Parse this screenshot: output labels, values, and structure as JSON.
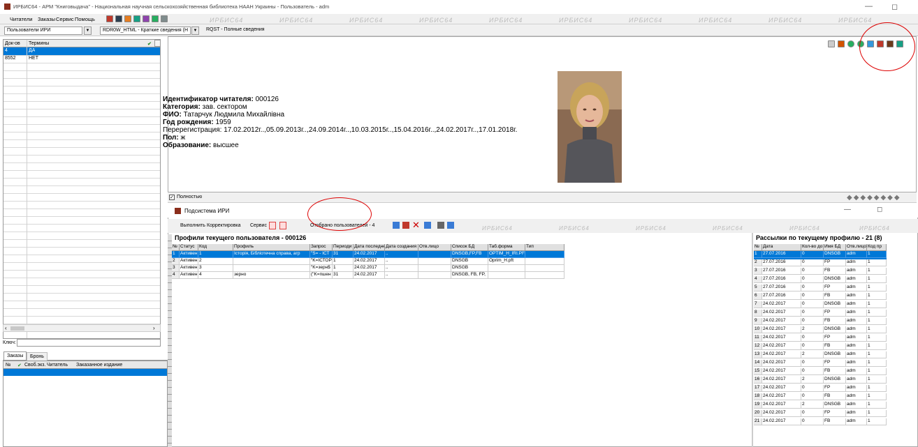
{
  "window": {
    "title": "ИРБИС64 - АРМ \"Книговыдача\" - Национальная научная сельскохозяйственная библиотека НААН Украины - Пользователь - adm",
    "minimize": "—",
    "restore": "◻"
  },
  "menu": [
    "Читатели",
    "Заказы",
    "Сервис",
    "Помощь"
  ],
  "watermark": "ИРБИС64",
  "selectors": {
    "users": "Пользователи ИРИ",
    "format": "RDR0W_HTML - Краткие сведения (Н",
    "query": "RQST - Полные сведения"
  },
  "left_grid": {
    "col1": "Док-ов",
    "col2": "Термины",
    "rows": [
      {
        "count": "4",
        "term": "ДА"
      },
      {
        "count": "8552",
        "term": "НЕТ"
      }
    ]
  },
  "key_label": "Ключ:",
  "bottom_tabs": [
    "Заказы",
    "Бронь"
  ],
  "bottom_grid": {
    "cols": [
      "№",
      "Своб.экз.",
      "Читатель",
      "Заказанное издание"
    ]
  },
  "reader": {
    "id_label": "Идентификатор читателя:",
    "id_value": "000126",
    "category_label": "Категория:",
    "category_value": "зав. сектором",
    "fio_label": "ФИО:",
    "fio_value": "Татарчук Людмила Михайлівна",
    "birth_label": "Год рождения:",
    "birth_value": "1959",
    "rereg_label": "Перерегистрация:",
    "rereg_value": "17.02.2012г..,05.09.2013г..,24.09.2014г..,10.03.2015г..,15.04.2016г..,24.02.2017г..,17.01.2018г.",
    "sex_label": "Пол:",
    "sex_value": "ж",
    "edu_label": "Образование:",
    "edu_value": "высшее"
  },
  "fully_label": "Полностью",
  "subsystem": {
    "title": "Подсистема ИРИ",
    "toolbar": {
      "run": "Выполнить",
      "correct": "Корректировка",
      "service": "Сервис",
      "selected": "Отобрано пользователей - 4"
    }
  },
  "profiles": {
    "header": "Профили текущего пользователя - 000126",
    "cols": [
      "№",
      "Статус",
      "Код",
      "Профиль",
      "Запрос",
      "Периоди",
      "Дата последне",
      "Дата создания",
      "Отв.лицо",
      "Список БД",
      "Таб.форма",
      "Тип"
    ],
    "rows": [
      [
        "1",
        "Активен",
        "1",
        "Історія, Бібліотечна справа, агр",
        "\"S= - ІСТ",
        "31",
        "24.02.2017",
        "..",
        "",
        "DNSGB,FP,FB",
        "OPTIM_H_IRI.PFT",
        ""
      ],
      [
        "2",
        "Активен",
        "2",
        "",
        "\"K=ІСТОР",
        "1",
        "24.02.2017",
        "..",
        "",
        "DNSGB",
        "Oprim_H.pft",
        ""
      ],
      [
        "3",
        "Активен",
        "3",
        "",
        "\"K=зерн$",
        "1",
        "24.02.2017",
        "..",
        "",
        "DNSGB",
        "",
        ""
      ],
      [
        "4",
        "Активен",
        "4",
        "зерно",
        "(\"K=пшен",
        "31",
        "24.02.2017",
        "..",
        "",
        "DNSGB, FB, FP,",
        "",
        ""
      ]
    ]
  },
  "mailings": {
    "header": "Рассылки по текущему профилю - 21 (8)",
    "cols": [
      "№",
      "Дата",
      "Кол-во до",
      "Имя БД",
      "Отв.лицо",
      "Код пр"
    ],
    "rows": [
      [
        "1",
        "27.07.2016",
        "0",
        "DNSGB",
        "adm",
        "1"
      ],
      [
        "2",
        "27.07.2016",
        "0",
        "FP",
        "adm",
        "1"
      ],
      [
        "3",
        "27.07.2016",
        "0",
        "FB",
        "adm",
        "1"
      ],
      [
        "4",
        "27.07.2016",
        "0",
        "DNSGB",
        "adm",
        "1"
      ],
      [
        "5",
        "27.07.2016",
        "0",
        "FP",
        "adm",
        "1"
      ],
      [
        "6",
        "27.07.2016",
        "0",
        "FB",
        "adm",
        "1"
      ],
      [
        "7",
        "24.02.2017",
        "0",
        "DNSGB",
        "adm",
        "1"
      ],
      [
        "8",
        "24.02.2017",
        "0",
        "FP",
        "adm",
        "1"
      ],
      [
        "9",
        "24.02.2017",
        "0",
        "FB",
        "adm",
        "1"
      ],
      [
        "10",
        "24.02.2017",
        "2",
        "DNSGB",
        "adm",
        "1"
      ],
      [
        "11",
        "24.02.2017",
        "0",
        "FP",
        "adm",
        "1"
      ],
      [
        "12",
        "24.02.2017",
        "0",
        "FB",
        "adm",
        "1"
      ],
      [
        "13",
        "24.02.2017",
        "2",
        "DNSGB",
        "adm",
        "1"
      ],
      [
        "14",
        "24.02.2017",
        "0",
        "FP",
        "adm",
        "1"
      ],
      [
        "15",
        "24.02.2017",
        "0",
        "FB",
        "adm",
        "1"
      ],
      [
        "16",
        "24.02.2017",
        "2",
        "DNSGB",
        "adm",
        "1"
      ],
      [
        "17",
        "24.02.2017",
        "0",
        "FP",
        "adm",
        "1"
      ],
      [
        "18",
        "24.02.2017",
        "0",
        "FB",
        "adm",
        "1"
      ],
      [
        "19",
        "24.02.2017",
        "2",
        "DNSGB",
        "adm",
        "1"
      ],
      [
        "20",
        "24.02.2017",
        "0",
        "FP",
        "adm",
        "1"
      ],
      [
        "21",
        "24.02.2017",
        "0",
        "FB",
        "adm",
        "1"
      ]
    ]
  }
}
